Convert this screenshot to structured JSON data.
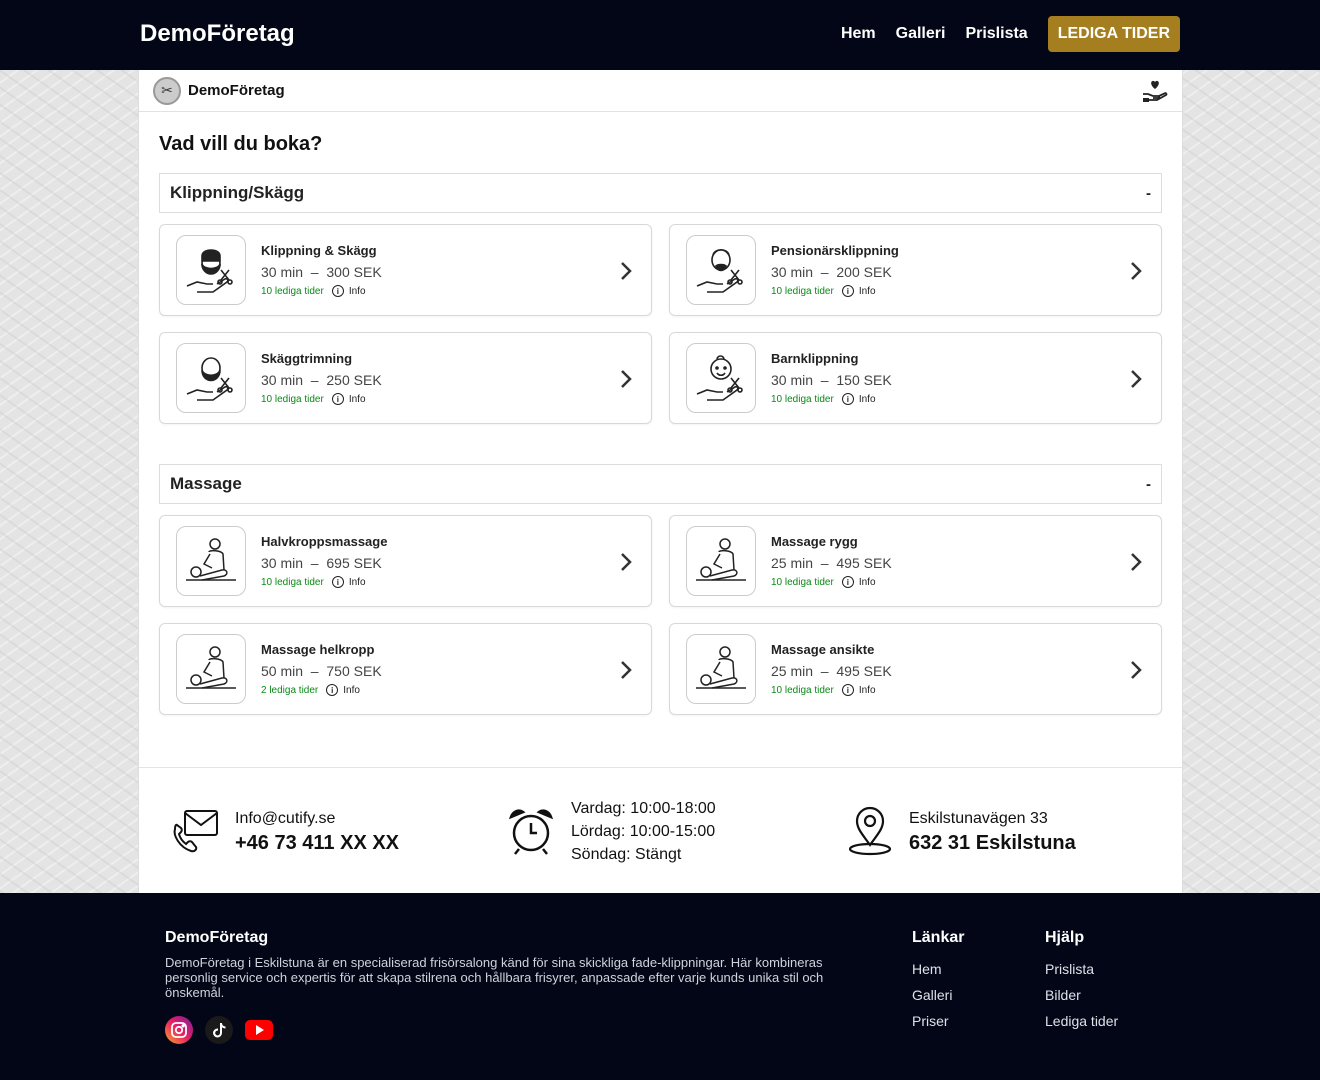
{
  "topbar": {
    "brand": "DemoFöretag",
    "nav": [
      "Hem",
      "Galleri",
      "Prislista"
    ],
    "cta": "LEDIGA TIDER"
  },
  "panel": {
    "company": "DemoFöretag",
    "question": "Vad vill du boka?",
    "categories": [
      {
        "name": "Klippning/Skägg",
        "toggle": "-",
        "services": [
          {
            "title": "Klippning & Skägg",
            "duration": "30 min",
            "price": "300 SEK",
            "available": "10 lediga tider",
            "info": "Info",
            "icon": "beard-man-icon"
          },
          {
            "title": "Pensionärsklippning",
            "duration": "30 min",
            "price": "200 SEK",
            "available": "10 lediga tider",
            "info": "Info",
            "icon": "old-man-icon"
          },
          {
            "title": "Skäggtrimning",
            "duration": "30 min",
            "price": "250 SEK",
            "available": "10 lediga tider",
            "info": "Info",
            "icon": "bald-beard-man-icon"
          },
          {
            "title": "Barnklippning",
            "duration": "30 min",
            "price": "150 SEK",
            "available": "10 lediga tider",
            "info": "Info",
            "icon": "child-icon"
          }
        ]
      },
      {
        "name": "Massage",
        "toggle": "-",
        "services": [
          {
            "title": "Halvkroppsmassage",
            "duration": "30 min",
            "price": "695 SEK",
            "available": "10 lediga tider",
            "info": "Info",
            "icon": "massage-icon"
          },
          {
            "title": "Massage rygg",
            "duration": "25 min",
            "price": "495 SEK",
            "available": "10 lediga tider",
            "info": "Info",
            "icon": "massage-icon"
          },
          {
            "title": "Massage helkropp",
            "duration": "50 min",
            "price": "750 SEK",
            "available": "2 lediga tider",
            "info": "Info",
            "icon": "massage-icon"
          },
          {
            "title": "Massage ansikte",
            "duration": "25 min",
            "price": "495 SEK",
            "available": "10 lediga tider",
            "info": "Info",
            "icon": "massage-icon"
          }
        ]
      }
    ]
  },
  "contact": {
    "email": "Info@cutify.se",
    "phone": "+46 73 411 XX XX",
    "hours": [
      "Vardag: 10:00-18:00",
      "Lördag: 10:00-15:00",
      "Söndag: Stängt"
    ],
    "street": "Eskilstunavägen 33",
    "city": "632 31 Eskilstuna"
  },
  "footer": {
    "title": "DemoFöretag",
    "description": "DemoFöretag i Eskilstuna är en specialiserad frisörsalong känd för sina skickliga fade-klippningar. Här kombineras personlig service och expertis för att skapa stilrena och hållbara frisyrer, anpassade efter varje kunds unika stil och önskemål.",
    "links_title": "Länkar",
    "links": [
      "Hem",
      "Galleri",
      "Priser"
    ],
    "help_title": "Hjälp",
    "help": [
      "Prislista",
      "Bilder",
      "Lediga tider"
    ]
  }
}
